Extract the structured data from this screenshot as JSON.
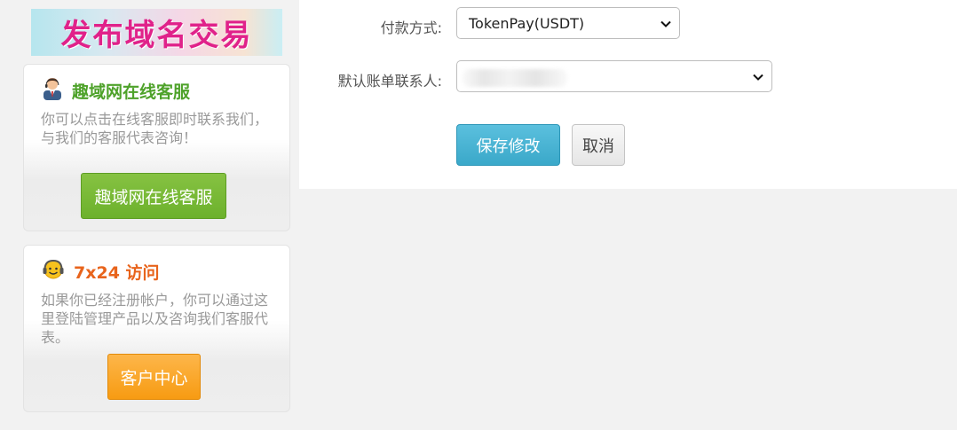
{
  "sidebar": {
    "banner_text": "发布域名交易",
    "support_card": {
      "title": "趣域网在线客服",
      "description": "你可以点击在线客服即时联系我们，与我们的客服代表咨询！",
      "button_label": "趣域网在线客服",
      "icon": "customer-service-person-icon",
      "title_color": "#4ea22a",
      "button_color": "#6cb12c"
    },
    "access_card": {
      "title": "7x24 访问",
      "description": "如果你已经注册帐户，你可以通过这里登陆管理产品以及咨询我们客服代表。",
      "button_label": "客户中心",
      "icon": "headset-smiley-icon",
      "title_color": "#e8641c",
      "button_color": "#f79b12"
    }
  },
  "form": {
    "payment_method": {
      "label": "付款方式:",
      "selected": "TokenPay(USDT)",
      "icon": "chevron-down-icon"
    },
    "default_contact": {
      "label": "默认账单联系人:",
      "selected": "",
      "icon": "chevron-down-icon"
    },
    "save_label": "保存修改",
    "cancel_label": "取消",
    "save_color": "#3aa8c9"
  }
}
